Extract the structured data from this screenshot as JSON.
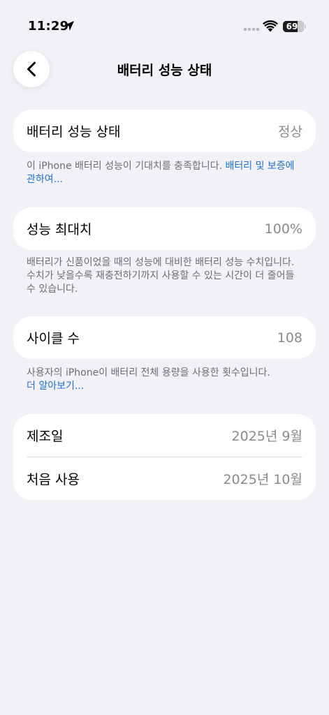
{
  "status_bar": {
    "time": "11:29",
    "battery_level": 69,
    "battery_text": "69"
  },
  "nav": {
    "title": "배터리 성능 상태"
  },
  "sections": {
    "health": {
      "label": "배터리 성능 상태",
      "value": "정상",
      "footer_text": "이 iPhone 배터리 성능이 기대치를 충족합니다. ",
      "footer_link": "배터리 및 보증에 관하여..."
    },
    "max_capacity": {
      "label": "성능 최대치",
      "value": "100%",
      "footer_text": "배터리가 신품이었을 때의 성능에 대비한 배터리 성능 수치입니다. 수치가 낮을수록 재충전하기까지 사용할 수 있는 시간이 더 줄어들 수 있습니다."
    },
    "cycle_count": {
      "label": "사이클 수",
      "value": "108",
      "footer_text": "사용자의 iPhone이 배터리 전체 용량을 사용한 횟수입니다.",
      "footer_link": "더 알아보기..."
    },
    "dates": {
      "manufacture_label": "제조일",
      "manufacture_value": "2025년 9월",
      "first_use_label": "처음 사용",
      "first_use_value": "2025년 10월"
    }
  },
  "colors": {
    "background": "#f2f1f6",
    "link": "#1a73d9",
    "secondary_text": "#8a8a8e"
  }
}
